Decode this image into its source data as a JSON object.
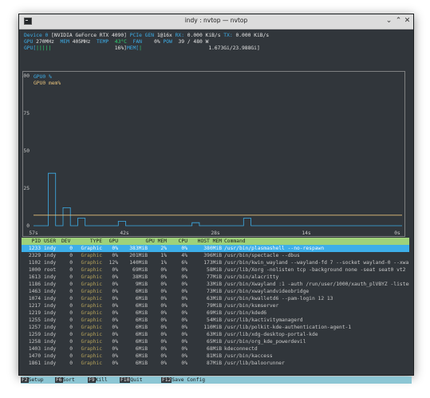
{
  "window": {
    "title": "indy : nvtop — nvtop"
  },
  "device": {
    "line1": {
      "label": "Device 0",
      "name": "[NVIDIA GeForce RTX 4090]",
      "pcie_label": "PCIe GEN",
      "pcie_value": "1@16x",
      "rx_label": "RX:",
      "rx_value": "0.000 KiB/s",
      "tx_label": "TX:",
      "tx_value": "0.000 KiB/s"
    },
    "line2": {
      "gpu_label": "GPU",
      "gpu_clock": "270MHz",
      "mem_label": "MEM",
      "mem_clock": "405MHz",
      "temp_label": "TEMP",
      "temp_value": "43°C",
      "fan_label": "FAN",
      "fan_value": "0%",
      "pow_label": "POW",
      "pow_value": "39 / 480 W"
    },
    "line3": {
      "gpu_bar_label": "GPU[",
      "gpu_bar_fill": "|||||",
      "gpu_bar_pct": "16%]",
      "mem_bar_label": "MEM[",
      "mem_bar_fill": "|",
      "mem_bar_value": "1.673Gi/23.988Gi]"
    }
  },
  "chart_data": {
    "type": "line",
    "title": "",
    "legend": [
      "GPU0 %",
      "GPU0 mem%"
    ],
    "legend_placement": "top-left",
    "y_ticks": [
      "100",
      "75",
      "50",
      "25",
      "0"
    ],
    "x_ticks": [
      "57s",
      "42s",
      "28s",
      "14s",
      "0s"
    ],
    "ylim": [
      0,
      100
    ],
    "grid": false,
    "series": [
      {
        "name": "GPU0 %",
        "color": "#3daee9",
        "values": [
          0,
          0,
          0,
          0,
          35,
          35,
          0,
          0,
          12,
          12,
          0,
          0,
          5,
          5,
          0,
          0,
          0,
          0,
          0,
          0,
          0,
          0,
          0,
          3,
          3,
          0,
          0,
          0,
          0,
          0,
          0,
          0,
          0,
          0,
          0,
          0,
          0,
          0,
          0,
          0,
          0,
          0,
          0,
          2,
          2,
          0,
          0,
          0,
          0,
          0,
          0,
          0,
          0,
          0,
          0,
          0,
          0,
          5,
          5,
          0,
          0,
          0,
          0,
          0,
          0,
          0,
          0,
          0,
          0,
          0,
          0,
          0,
          0,
          0,
          0,
          0,
          0,
          0,
          0,
          0,
          0,
          0,
          0,
          0,
          0,
          0,
          0,
          0,
          0,
          0,
          0,
          0,
          0,
          0,
          0,
          0,
          0,
          0,
          0,
          0
        ]
      },
      {
        "name": "GPU0 mem%",
        "color": "#e5c07b",
        "values": [
          7,
          7,
          7,
          7,
          7,
          7,
          7,
          7,
          7,
          7,
          7,
          7,
          7,
          7,
          7,
          7,
          7,
          7,
          7,
          7,
          7,
          7,
          7,
          7,
          7,
          7,
          7,
          7,
          7,
          7,
          7,
          7,
          7,
          7,
          7,
          7,
          7,
          7,
          7,
          7,
          7,
          7,
          7,
          7,
          7,
          7,
          7,
          7,
          7,
          7,
          7,
          7,
          7,
          7,
          7,
          7,
          7,
          7,
          7,
          7,
          7,
          7,
          7,
          7,
          7,
          7,
          7,
          7,
          7,
          7,
          7,
          7,
          7,
          7,
          7,
          7,
          7,
          7,
          7,
          7,
          7,
          7,
          7,
          7,
          7,
          7,
          7,
          7,
          7,
          7,
          7,
          7,
          7,
          7,
          7,
          7,
          7,
          7,
          7,
          7
        ]
      }
    ]
  },
  "process_table": {
    "headers": [
      "PID",
      "USER",
      "DEV",
      "TYPE",
      "GPU",
      "GPU MEM",
      "CPU",
      "HOST MEM",
      "Command"
    ],
    "rows": [
      {
        "pid": "1233",
        "user": "indy",
        "dev": "0",
        "type": "Graphic",
        "gpu": "0%",
        "gpu_mem": "383MiB",
        "gpu_mem_pct": "2%",
        "cpu": "0%",
        "host_mem": "380MiB",
        "command": "/usr/bin/plasmashell --no-respawn"
      },
      {
        "pid": "2329",
        "user": "indy",
        "dev": "0",
        "type": "Graphic",
        "gpu": "0%",
        "gpu_mem": "201MiB",
        "gpu_mem_pct": "1%",
        "cpu": "4%",
        "host_mem": "396MiB",
        "command": "/usr/bin/spectacle --dbus"
      },
      {
        "pid": "1102",
        "user": "indy",
        "dev": "0",
        "type": "Graphic",
        "gpu": "12%",
        "gpu_mem": "140MiB",
        "gpu_mem_pct": "1%",
        "cpu": "6%",
        "host_mem": "173MiB",
        "command": "/usr/bin/kwin_wayland --wayland-fd 7 --socket wayland-0 --xwa"
      },
      {
        "pid": "1000",
        "user": "root",
        "dev": "0",
        "type": "Graphic",
        "gpu": "0%",
        "gpu_mem": "69MiB",
        "gpu_mem_pct": "0%",
        "cpu": "0%",
        "host_mem": "58MiB",
        "command": "/usr/lib/Xorg -nolisten tcp -background none -seat seat0 vt2"
      },
      {
        "pid": "1613",
        "user": "indy",
        "dev": "0",
        "type": "Graphic",
        "gpu": "0%",
        "gpu_mem": "38MiB",
        "gpu_mem_pct": "0%",
        "cpu": "0%",
        "host_mem": "77MiB",
        "command": "/usr/bin/alacritty"
      },
      {
        "pid": "1186",
        "user": "indy",
        "dev": "0",
        "type": "Graphic",
        "gpu": "0%",
        "gpu_mem": "9MiB",
        "gpu_mem_pct": "0%",
        "cpu": "0%",
        "host_mem": "33MiB",
        "command": "/usr/bin/Xwayland :1 -auth /run/user/1000/xauth_plVBYZ -listen"
      },
      {
        "pid": "1463",
        "user": "indy",
        "dev": "0",
        "type": "Graphic",
        "gpu": "0%",
        "gpu_mem": "6MiB",
        "gpu_mem_pct": "0%",
        "cpu": "0%",
        "host_mem": "73MiB",
        "command": "/usr/bin/xwaylandvideobridge"
      },
      {
        "pid": "1074",
        "user": "indy",
        "dev": "0",
        "type": "Graphic",
        "gpu": "0%",
        "gpu_mem": "6MiB",
        "gpu_mem_pct": "0%",
        "cpu": "0%",
        "host_mem": "63MiB",
        "command": "/usr/bin/kwalletd6 --pam-login 12 13"
      },
      {
        "pid": "1217",
        "user": "indy",
        "dev": "0",
        "type": "Graphic",
        "gpu": "0%",
        "gpu_mem": "6MiB",
        "gpu_mem_pct": "0%",
        "cpu": "0%",
        "host_mem": "79MiB",
        "command": "/usr/bin/ksmserver"
      },
      {
        "pid": "1219",
        "user": "indy",
        "dev": "0",
        "type": "Graphic",
        "gpu": "0%",
        "gpu_mem": "6MiB",
        "gpu_mem_pct": "0%",
        "cpu": "0%",
        "host_mem": "69MiB",
        "command": "/usr/bin/kded6"
      },
      {
        "pid": "1255",
        "user": "indy",
        "dev": "0",
        "type": "Graphic",
        "gpu": "0%",
        "gpu_mem": "6MiB",
        "gpu_mem_pct": "0%",
        "cpu": "0%",
        "host_mem": "54MiB",
        "command": "/usr/lib/kactivitymanagerd"
      },
      {
        "pid": "1257",
        "user": "indy",
        "dev": "0",
        "type": "Graphic",
        "gpu": "0%",
        "gpu_mem": "6MiB",
        "gpu_mem_pct": "0%",
        "cpu": "0%",
        "host_mem": "110MiB",
        "command": "/usr/lib/polkit-kde-authentication-agent-1"
      },
      {
        "pid": "1259",
        "user": "indy",
        "dev": "0",
        "type": "Graphic",
        "gpu": "0%",
        "gpu_mem": "6MiB",
        "gpu_mem_pct": "0%",
        "cpu": "0%",
        "host_mem": "63MiB",
        "command": "/usr/lib/xdg-desktop-portal-kde"
      },
      {
        "pid": "1258",
        "user": "indy",
        "dev": "0",
        "type": "Graphic",
        "gpu": "0%",
        "gpu_mem": "6MiB",
        "gpu_mem_pct": "0%",
        "cpu": "0%",
        "host_mem": "65MiB",
        "command": "/usr/bin/org_kde_powerdevil"
      },
      {
        "pid": "1403",
        "user": "indy",
        "dev": "0",
        "type": "Graphic",
        "gpu": "0%",
        "gpu_mem": "6MiB",
        "gpu_mem_pct": "0%",
        "cpu": "0%",
        "host_mem": "68MiB",
        "command": "kdeconnectd"
      },
      {
        "pid": "1470",
        "user": "indy",
        "dev": "0",
        "type": "Graphic",
        "gpu": "0%",
        "gpu_mem": "6MiB",
        "gpu_mem_pct": "0%",
        "cpu": "0%",
        "host_mem": "81MiB",
        "command": "/usr/bin/kaccess"
      },
      {
        "pid": "1861",
        "user": "indy",
        "dev": "0",
        "type": "Graphic",
        "gpu": "0%",
        "gpu_mem": "6MiB",
        "gpu_mem_pct": "0%",
        "cpu": "0%",
        "host_mem": "87MiB",
        "command": "/usr/lib/baloorunner"
      }
    ]
  },
  "footer": [
    {
      "key": "F2",
      "label": "Setup"
    },
    {
      "key": "F6",
      "label": "Sort"
    },
    {
      "key": "F9",
      "label": "Kill"
    },
    {
      "key": "F10",
      "label": "Quit"
    },
    {
      "key": "F12",
      "label": "Save Config"
    }
  ],
  "colors": {
    "accent": "#3daee9",
    "background": "#31363b",
    "header_bg": "#9fd27a",
    "footer_bg": "#8cc6d4",
    "type_graphic": "#b5a25a"
  }
}
